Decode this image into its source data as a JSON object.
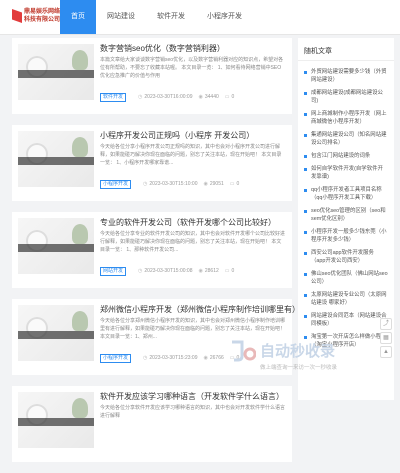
{
  "logo": {
    "line1": "鼎易娱乐网络",
    "line2": "科技有限公司",
    "color": "#e23c3c"
  },
  "nav": [
    {
      "label": "首页",
      "active": true
    },
    {
      "label": "网站建设",
      "active": false
    },
    {
      "label": "软件开发",
      "active": false
    },
    {
      "label": "小程序开发",
      "active": false
    }
  ],
  "articles": [
    {
      "title": "数字营销seo优化（数字营销利器）",
      "summary": "本篇文章给大家谈谈数字营销seo优化，以及数字营销利器对应的知识点，希望对各位有所帮助，不要忘了收藏本站喔。 本文目录一览： 1、如何看待网络营销中SEO优化应急推广的价值与作用",
      "tag": "软件开发",
      "date": "2023-03-30T16:00:09",
      "views": "34440",
      "comments": "0"
    },
    {
      "title": "小程序开发公司正规吗（小程序 开发公司）",
      "summary": "今天给各位分享小程序开发公司正规吗的知识，其中也会对小程序开发公司进行解释，如果能碰巧解决你现在面临的问题，别忘了关注本站，现在开始吧！ 本文目录一览： 1、小程序开发哪家靠谱...",
      "tag": "小程序开发",
      "date": "2023-03-30T15:10:00",
      "views": "29051",
      "comments": "0"
    },
    {
      "title": "专业的软件开发公司（软件开发哪个公司比较好）",
      "summary": "今天给各位分享专业的软件开发公司的知识，其中也会对软件开发哪个公司比较好进行解释，如果能碰巧解决你现在面临的问题，别忘了关注本站，现在开始吧！ 本文目录一览： 1、那种软件开发公司...",
      "tag": "网站开发",
      "date": "2023-03-30T15:00:08",
      "views": "28612",
      "comments": "0"
    },
    {
      "title": "郑州微信小程序开发（郑州微信小程序制作培训哪里有）",
      "summary": "今天给各位分享郑州微信小程序开发的知识，其中也会对郑州微信小程序制作培训哪里有进行解释，如果能碰巧解决你现在面临的问题，别忘了关注本站，现在开始吧！本文目录一览：1、郑州...",
      "tag": "小程序开发",
      "date": "2023-03-30T15:23:09",
      "views": "26766",
      "comments": "0"
    },
    {
      "title": "软件开发应该学习哪种语言（开发软件学什么语言）",
      "summary": "今天给各位分享软件开发应该学习哪种语言的知识，其中也会对开发软件学什么语言进行解释",
      "tag": "软件开发",
      "date": "",
      "views": "",
      "comments": ""
    }
  ],
  "sidebar": {
    "title": "随机文章",
    "items": [
      "外贸网站建设需要多少钱（外贸 网站建设）",
      "成都网站建设(成都网站建设公司)",
      "网上商城制作小程序开发（网上商城微信小程序开发）",
      "集通网站建设公司（知名网站建设公司排名）",
      "包含江门网站建设的词条",
      "如何自学软件开发(自学软件开发靠谱)",
      "qq小程序开发者工具项目名称（qq小程序开发工具下载）",
      "seo优化seo管理的区别（seo和sem优化区别）",
      "小程序开发一般多少钱东莞（小程序开发多少钱）",
      "西安公司app软件开发服务（app开发公司西安）",
      "佛山seo优化团队（佛山网站seo公司）",
      "太原网站建设专业公司（太原网站建设 哪家好）",
      "网站建设合同范本（网站建设合同模板）",
      "淘宝第一次开店怎么样做小程序（淘宝小程序开店）"
    ]
  },
  "watermark": {
    "main": "自动秒收录",
    "sub": "做上端查询一来访一次一秒收录"
  },
  "icons": {
    "date": "clock-icon",
    "views": "eye-icon",
    "comments": "comment-icon"
  }
}
